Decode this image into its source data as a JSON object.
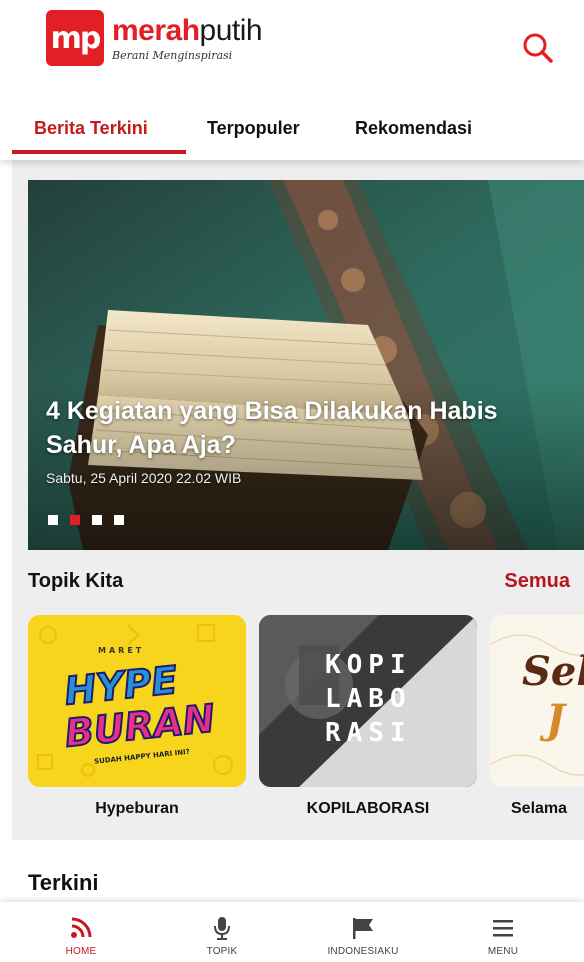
{
  "brand": {
    "name_part1": "merah",
    "name_part2": "putih",
    "tagline": "Berani Menginspirasi",
    "logo_mark": "mp",
    "accent_color": "#e31e24"
  },
  "tabs": [
    {
      "label": "Berita Terkini",
      "active": true
    },
    {
      "label": "Terpopuler",
      "active": false
    },
    {
      "label": "Rekomendasi",
      "active": false
    }
  ],
  "hero": {
    "title": "4 Kegiatan yang Bisa Dilakukan Habis Sahur, Apa Aja?",
    "date": "Sabtu, 25 April 2020 22.02 WIB",
    "slide_count": 4,
    "active_slide": 2
  },
  "topics": {
    "title": "Topik Kita",
    "see_all": "Semua",
    "items": [
      {
        "label": "Hypeburan",
        "art_line1": "HYPE",
        "art_line2": "BURAN",
        "art_top": "MARET",
        "art_bottom": "SUDAH HAPPY HARI INI?"
      },
      {
        "label": "KOPILABORASI",
        "art_line1": "KOPI",
        "art_line2": "LABO",
        "art_line3": "RASI"
      },
      {
        "label": "Selama",
        "art_line1": "Sel",
        "art_line2": "J"
      }
    ]
  },
  "terkini": {
    "title": "Terkini"
  },
  "bottom_nav": [
    {
      "label": "HOME",
      "icon": "rss-icon",
      "active": true
    },
    {
      "label": "TOPIK",
      "icon": "microphone-icon",
      "active": false
    },
    {
      "label": "INDONESIAKU",
      "icon": "flag-icon",
      "active": false
    },
    {
      "label": "MENU",
      "icon": "hamburger-icon",
      "active": false
    }
  ]
}
